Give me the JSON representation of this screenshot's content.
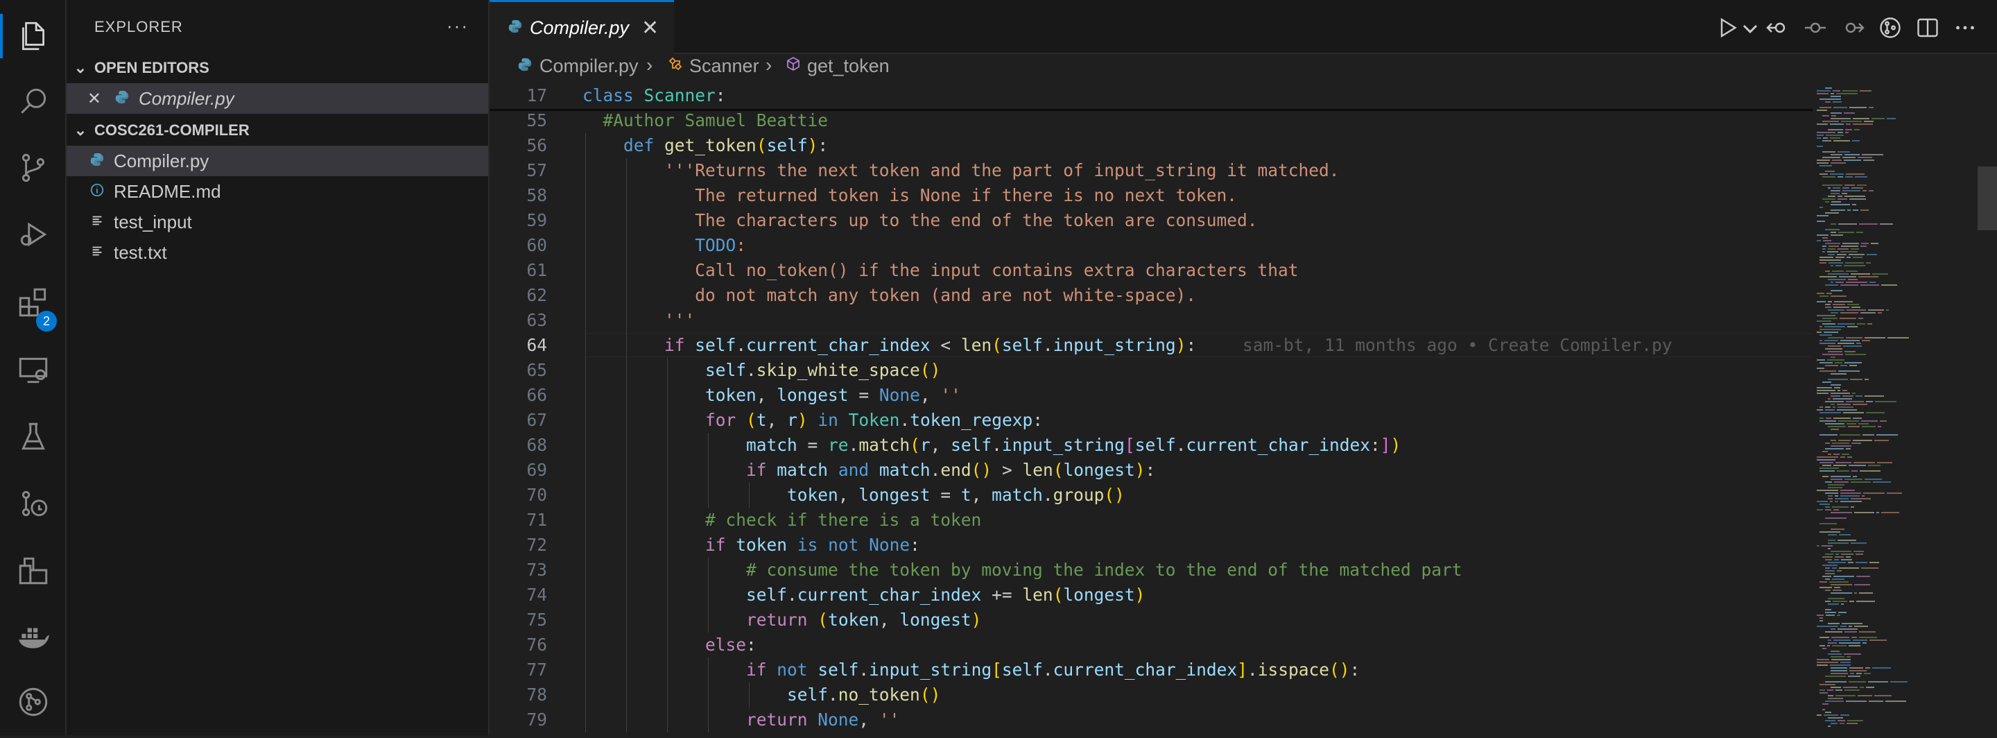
{
  "activity_bar": {
    "extensions_badge": "2"
  },
  "sidebar": {
    "title": "EXPLORER",
    "more_actions": "···",
    "open_editors_label": "OPEN EDITORS",
    "open_editors": [
      {
        "name": "Compiler.py"
      }
    ],
    "folder_label": "COSC261-COMPILER",
    "files": [
      {
        "name": "Compiler.py",
        "icon": "python-file-icon"
      },
      {
        "name": "README.md",
        "icon": "info-file-icon"
      },
      {
        "name": "test_input",
        "icon": "text-file-icon"
      },
      {
        "name": "test.txt",
        "icon": "text-file-icon"
      }
    ]
  },
  "editor": {
    "tab_label": "Compiler.py",
    "breadcrumb": {
      "file": "Compiler.py",
      "class": "Scanner",
      "method": "get_token"
    },
    "blame": "sam-bt, 11 months ago • Create Compiler.py",
    "lines": [
      {
        "n": "17",
        "t": "class Scanner:"
      },
      {
        "n": "55",
        "t": "  #Author Samuel Beattie"
      },
      {
        "n": "56",
        "t": "    def get_token(self):"
      },
      {
        "n": "57",
        "t": "        '''Returns the next token and the part of input_string it matched."
      },
      {
        "n": "58",
        "t": "           The returned token is None if there is no next token."
      },
      {
        "n": "59",
        "t": "           The characters up to the end of the token are consumed."
      },
      {
        "n": "60",
        "t": "           TODO:"
      },
      {
        "n": "61",
        "t": "           Call no_token() if the input contains extra characters that"
      },
      {
        "n": "62",
        "t": "           do not match any token (and are not white-space)."
      },
      {
        "n": "63",
        "t": "        '''"
      },
      {
        "n": "64",
        "t": "        if self.current_char_index < len(self.input_string):"
      },
      {
        "n": "65",
        "t": "            self.skip_white_space()"
      },
      {
        "n": "66",
        "t": "            token, longest = None, ''"
      },
      {
        "n": "67",
        "t": "            for (t, r) in Token.token_regexp:"
      },
      {
        "n": "68",
        "t": "                match = re.match(r, self.input_string[self.current_char_index:])"
      },
      {
        "n": "69",
        "t": "                if match and match.end() > len(longest):"
      },
      {
        "n": "70",
        "t": "                    token, longest = t, match.group()"
      },
      {
        "n": "71",
        "t": "            # check if there is a token"
      },
      {
        "n": "72",
        "t": "            if token is not None:"
      },
      {
        "n": "73",
        "t": "                # consume the token by moving the index to the end of the matched part"
      },
      {
        "n": "74",
        "t": "                self.current_char_index += len(longest)"
      },
      {
        "n": "75",
        "t": "                return (token, longest)"
      },
      {
        "n": "76",
        "t": "            else:"
      },
      {
        "n": "77",
        "t": "                if not self.input_string[self.current_char_index].isspace():"
      },
      {
        "n": "78",
        "t": "                    self.no_token()"
      },
      {
        "n": "79",
        "t": "                return None, ''"
      }
    ]
  }
}
